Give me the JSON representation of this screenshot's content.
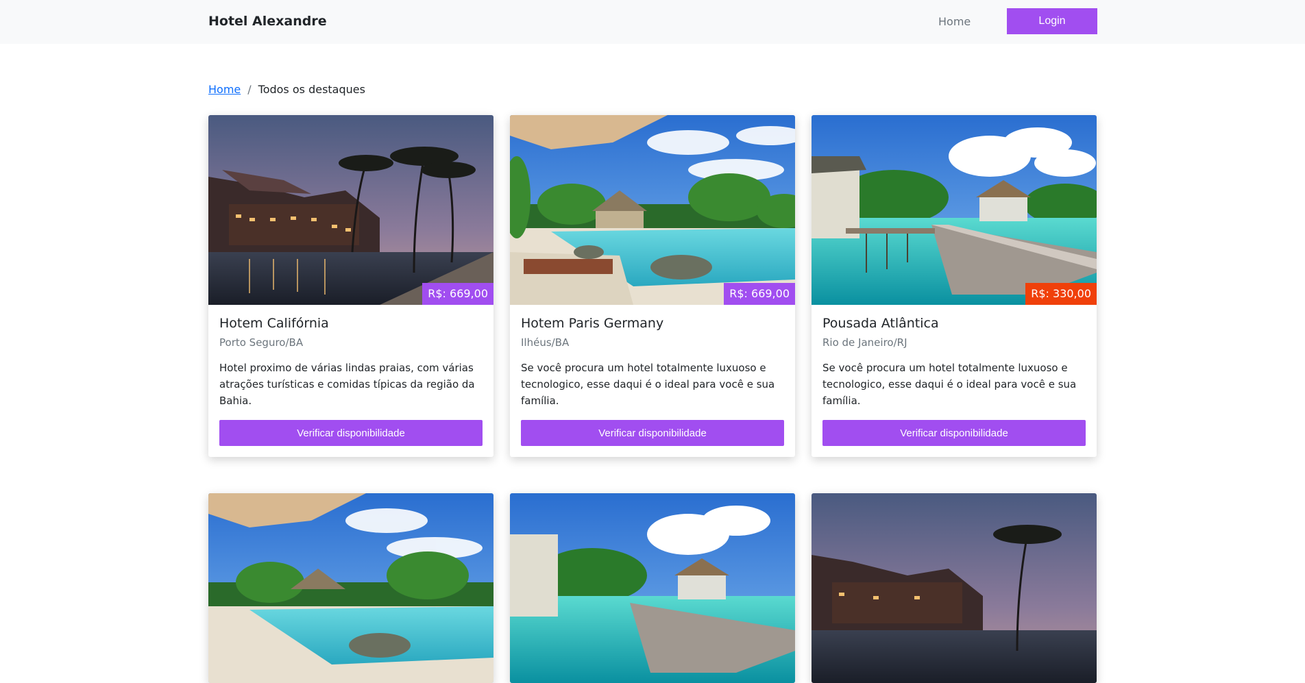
{
  "navbar": {
    "brand": "Hotel Alexandre",
    "home_link": "Home",
    "login_button": "Login",
    "accent_color": "#a14ef0"
  },
  "breadcrumb": {
    "home": "Home",
    "separator": "/",
    "current": "Todos os destaques"
  },
  "cards": [
    {
      "title": "Hotem Califórnia",
      "location": "Porto Seguro/BA",
      "description": "Hotel proximo de várias lindas praias, com várias atrações turísticas e comidas típicas da região da Bahia.",
      "price": "R$: 669,00",
      "price_color": "#a14ef0",
      "image": "night-resort-palms",
      "button": "Verificar disponibilidade"
    },
    {
      "title": "Hotem Paris Germany",
      "location": "Ilhéus/BA",
      "description": "Se você procura um hotel totalmente luxuoso e tecnologico, esse daqui é o ideal para você e sua família.",
      "price": "R$: 669,00",
      "price_color": "#a14ef0",
      "image": "pool-umbrella",
      "button": "Verificar disponibilidade"
    },
    {
      "title": "Pousada Atlântica",
      "location": "Rio de Janeiro/RJ",
      "description": "Se você procura um hotel totalmente luxuoso e tecnologico, esse daqui é o ideal para você e sua família.",
      "price": "R$: 330,00",
      "price_color": "#f0400a",
      "image": "overwater-bungalow",
      "button": "Verificar disponibilidade"
    }
  ],
  "row2_images": [
    "pool-umbrella",
    "overwater-bungalow",
    "night-resort-palms"
  ]
}
